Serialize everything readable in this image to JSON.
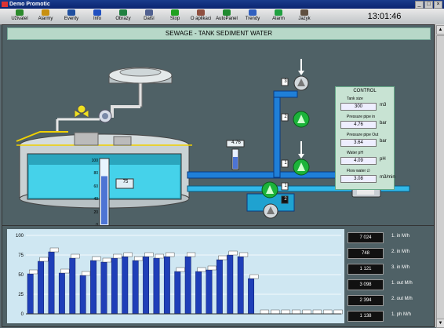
{
  "window": {
    "title": "Demo Promotic"
  },
  "toolbar": {
    "buttons": [
      {
        "label": "Uživatel",
        "icon": "user-icon",
        "color": "#2c8a2c"
      },
      {
        "label": "Alarmy",
        "icon": "alarm-icon",
        "color": "#c89010"
      },
      {
        "label": "Eventy",
        "icon": "event-icon",
        "color": "#2050a0"
      },
      {
        "label": "Info",
        "icon": "info-icon",
        "color": "#2050c0"
      },
      {
        "label": "Obrazy",
        "icon": "screens-icon",
        "color": "#208040"
      },
      {
        "label": "Další",
        "icon": "next-icon",
        "color": "#506090"
      },
      {
        "label": "Stop",
        "icon": "stop-icon",
        "color": "#20a020"
      },
      {
        "label": "O aplikaci",
        "icon": "about-icon",
        "color": "#905040"
      },
      {
        "label": "AutoPanel",
        "icon": "autopanel-icon",
        "color": "#208a30"
      },
      {
        "label": "Trendy",
        "icon": "trend-icon",
        "color": "#3060c0"
      },
      {
        "label": "Alarm",
        "icon": "alarm-bell-icon",
        "color": "#20a040"
      },
      {
        "label": "Jazyk",
        "icon": "language-icon",
        "color": "#605040"
      }
    ],
    "clock": "13:01:46"
  },
  "scheme": {
    "title": "SEWAGE - TANK SEDIMENT WATER",
    "tank_level_display": "75",
    "gauge_value": "4.76",
    "level_scale": [
      "100",
      "80",
      "60",
      "40",
      "20",
      "0"
    ],
    "tank_level_percent": 75,
    "pump_labels": [
      "3",
      "2",
      "1",
      "1",
      "2"
    ],
    "colors": {
      "water": "#38c8e0",
      "pipe": "#1f6fd0",
      "pump": "#1cb33a"
    }
  },
  "control": {
    "title": "CONTROL",
    "rows": [
      {
        "label": "Tank size",
        "value": "300",
        "unit": "m3"
      },
      {
        "label": "Pressure pipe  in",
        "value": "4.76",
        "unit": "bar"
      },
      {
        "label": "Pressure pipe Out",
        "value": "3.64",
        "unit": "bar"
      },
      {
        "label": "Water pH",
        "value": "4.09",
        "unit": "pH"
      },
      {
        "label": "Flow water ∅",
        "value": "3.08",
        "unit": "m3/min"
      }
    ]
  },
  "chart_data": {
    "type": "bar",
    "y_ticks": [
      "100",
      "75",
      "50",
      "25",
      "0"
    ],
    "ylim": [
      0,
      100
    ],
    "values": [
      51,
      67,
      79,
      52,
      71,
      49,
      68,
      66,
      71,
      73,
      68,
      73,
      71,
      73,
      54,
      73,
      54,
      56,
      69,
      75,
      73,
      45,
      0,
      0,
      0,
      0,
      0,
      0,
      0,
      0
    ],
    "grid": true
  },
  "stats": [
    {
      "value": "7 024",
      "label": "1. in M/h"
    },
    {
      "value": "748",
      "label": "2. in M/h"
    },
    {
      "value": "1 121",
      "label": "3. in M/h"
    },
    {
      "value": "3 098",
      "label": "1. out M/h"
    },
    {
      "value": "2 394",
      "label": "2. out M/h"
    },
    {
      "value": "1 138",
      "label": "1. ph M/h"
    }
  ]
}
